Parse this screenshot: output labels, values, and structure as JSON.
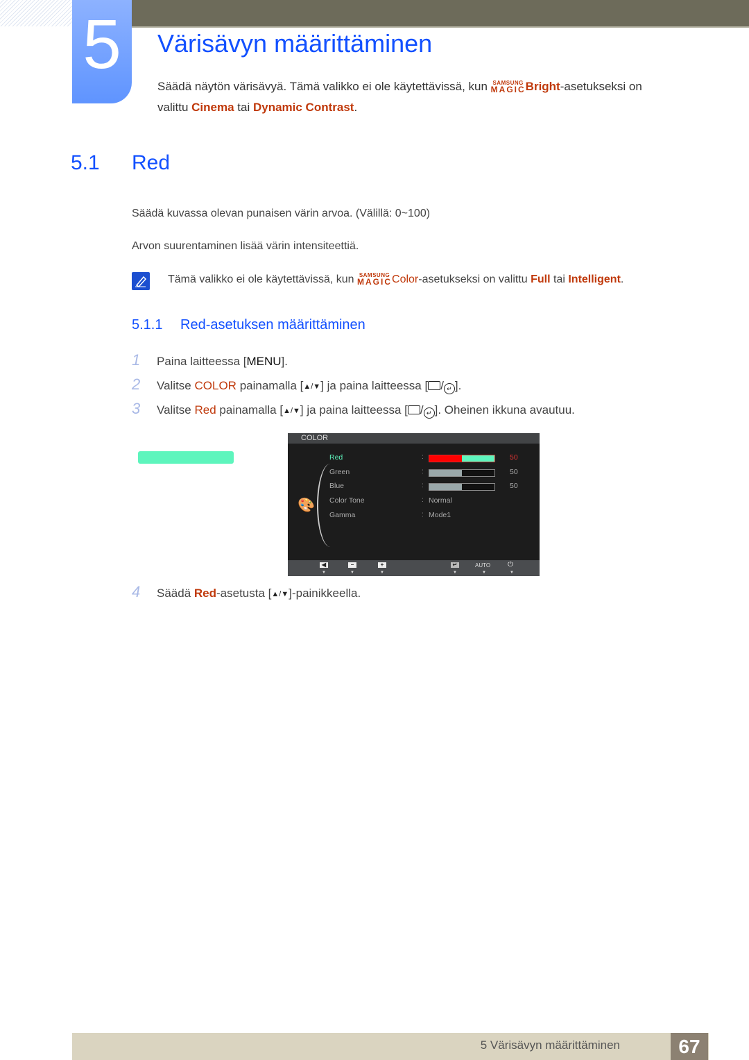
{
  "chapter": {
    "number": "5",
    "title": "Värisävyn määrittäminen",
    "intro_part1": "Säädä näytön värisävyä. Tämä valikko ei ole käytettävissä, kun ",
    "magic_top": "SAMSUNG",
    "magic_bottom": "MAGIC",
    "magic_bright": "Bright",
    "intro_part2": "-asetukseksi on",
    "intro_line2_a": "valittu ",
    "cinema": "Cinema",
    "tai": " tai ",
    "dynamic_contrast": "Dynamic Contrast",
    "period": "."
  },
  "section": {
    "number": "5.1",
    "title": "Red",
    "para1": "Säädä kuvassa olevan punaisen värin arvoa. (Välillä: 0~100)",
    "para2": "Arvon suurentaminen lisää värin intensiteettiä.",
    "note_part1": "Tämä valikko ei ole käytettävissä, kun ",
    "note_magic_color": "Color",
    "note_part2": "-asetukseksi on valittu ",
    "note_full": "Full",
    "note_tai": " tai ",
    "note_intelligent": "Intelligent",
    "note_end": "."
  },
  "subsection": {
    "number": "5.1.1",
    "title": "Red-asetuksen määrittäminen"
  },
  "steps": [
    {
      "n": "1",
      "a": "Paina laitteessa [",
      "b": "MENU",
      "c": "]."
    },
    {
      "n": "2",
      "a": "Valitse ",
      "em": "COLOR",
      "b": " painamalla [",
      "arrows": "▲/▼",
      "c": "] ja paina laitteessa [",
      "d": "]."
    },
    {
      "n": "3",
      "a": "Valitse ",
      "em": "Red",
      "b": " painamalla [",
      "arrows": "▲/▼",
      "c": "] ja paina laitteessa [",
      "d": "]. Oheinen ikkuna avautuu."
    },
    {
      "n": "4",
      "a": "Säädä ",
      "em": "Red",
      "b": "-asetusta [",
      "arrows": "▲/▼",
      "c": "]-painikkeella."
    }
  ],
  "osd": {
    "title": "COLOR",
    "items": [
      {
        "label": "Red",
        "type": "slider",
        "value": 50,
        "selected": true
      },
      {
        "label": "Green",
        "type": "slider",
        "value": 50
      },
      {
        "label": "Blue",
        "type": "slider",
        "value": 50
      },
      {
        "label": "Color Tone",
        "type": "text",
        "value": "Normal"
      },
      {
        "label": "Gamma",
        "type": "text",
        "value": "Mode1"
      }
    ],
    "footer": {
      "auto_label": "AUTO",
      "left": "◀",
      "minus": "−",
      "plus": "+",
      "enter": "↵",
      "power": "⏻"
    },
    "colors": {
      "highlight": "#5ef5bd",
      "red_fill": "#ff0000",
      "selected_label": "#5ef5bd"
    }
  },
  "footer": {
    "text": "5 Värisävyn määrittäminen",
    "page": "67"
  }
}
